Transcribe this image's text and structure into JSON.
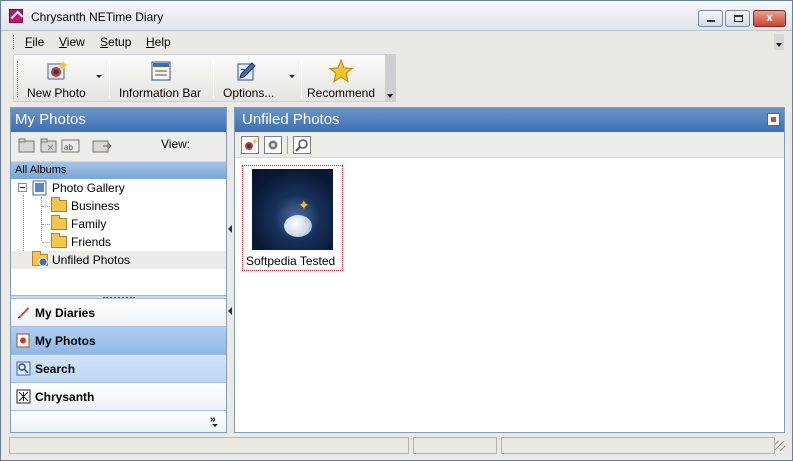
{
  "window": {
    "title": "Chrysanth NETime Diary",
    "close_label": "x"
  },
  "menu": [
    {
      "label": "File",
      "accel": "F"
    },
    {
      "label": "View",
      "accel": "V"
    },
    {
      "label": "Setup",
      "accel": "S"
    },
    {
      "label": "Help",
      "accel": "H"
    }
  ],
  "toolbar": {
    "new_photo": "New Photo",
    "information_bar": "Information Bar",
    "options": "Options...",
    "recommend": "Recommend"
  },
  "left_pane": {
    "title": "My Photos",
    "view_label": "View:",
    "all_albums": "All Albums",
    "tree": {
      "root": "Photo Gallery",
      "children": [
        "Business",
        "Family",
        "Friends"
      ],
      "unfiled": "Unfiled Photos"
    },
    "nav": [
      "My Diaries",
      "My Photos",
      "Search",
      "Chrysanth"
    ],
    "more_chevron": "»"
  },
  "right_pane": {
    "title": "Unfiled Photos",
    "items": [
      {
        "caption": "Softpedia Tested"
      }
    ]
  },
  "colors": {
    "header_blue": "#4f7fbf",
    "nav_active": "#9dc2ee",
    "selection_border": "#cc2233"
  }
}
